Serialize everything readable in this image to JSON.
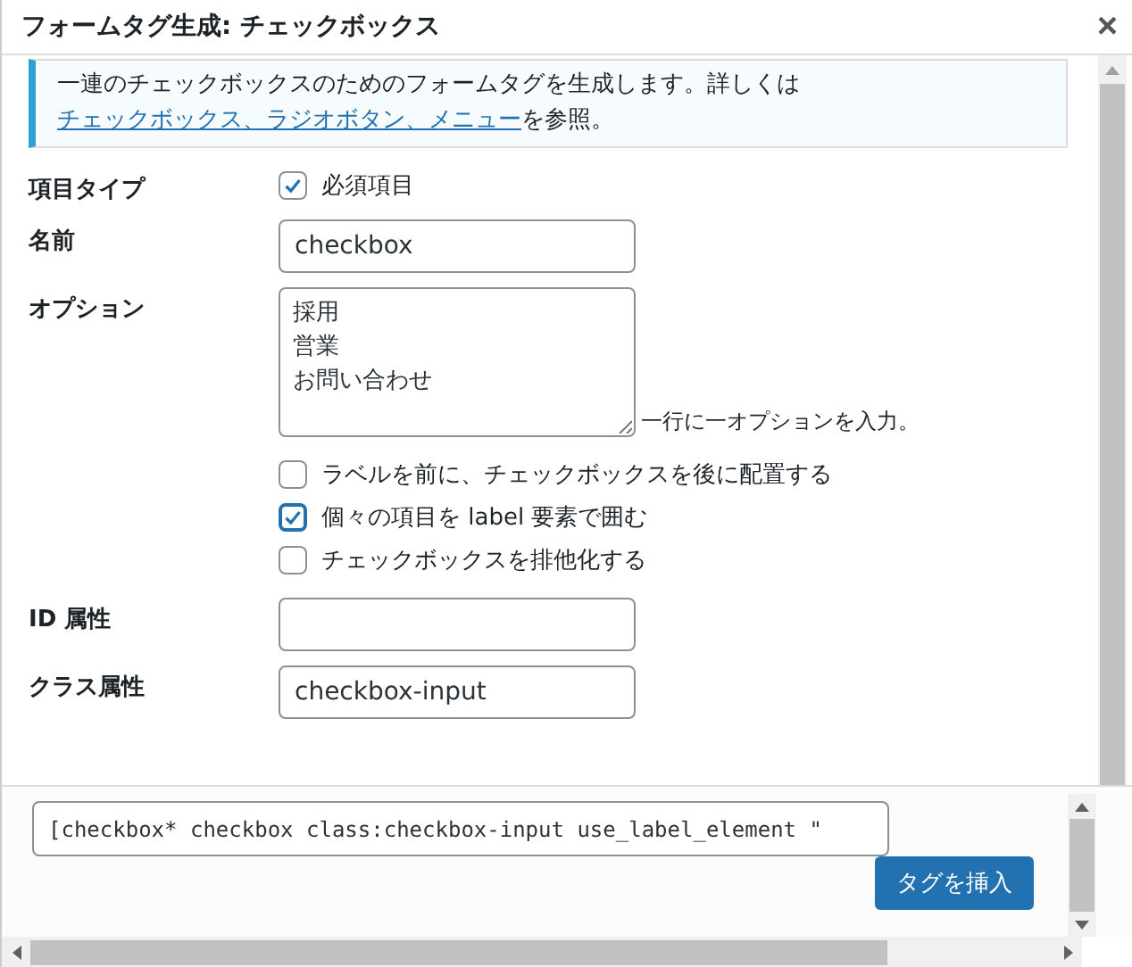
{
  "dialog": {
    "title": "フォームタグ生成: チェックボックス",
    "close": "×"
  },
  "notice": {
    "text": "一連のチェックボックスのためのフォームタグを生成します。詳しくは",
    "link": "チェックボックス、ラジオボタン、メニュー",
    "suffix": "を参照。"
  },
  "fields": [
    {
      "kind": "checkbox",
      "label": "項目タイプ",
      "options": [
        {
          "label": "必須項目",
          "checked": true
        }
      ]
    },
    {
      "kind": "text",
      "label": "名前",
      "value": "checkbox"
    },
    {
      "kind": "textarea",
      "label": "オプション",
      "lines": [
        "採用",
        "営業",
        "お問い合わせ"
      ],
      "hint": "一行に一オプションを入力。",
      "options": [
        {
          "label": "ラベルを前に、チェックボックスを後に配置する",
          "checked": false
        },
        {
          "label": "個々の項目を label 要素で囲む",
          "checked": true
        },
        {
          "label": "チェックボックスを排他化する",
          "checked": false
        }
      ]
    },
    {
      "kind": "text",
      "label": "ID 属性"
    },
    {
      "kind": "text",
      "label": "クラス属性",
      "value": "checkbox-input"
    }
  ],
  "footer": {
    "tag": "[checkbox* checkbox class:checkbox-input use_label_element \"",
    "button": "タグを挿入"
  }
}
